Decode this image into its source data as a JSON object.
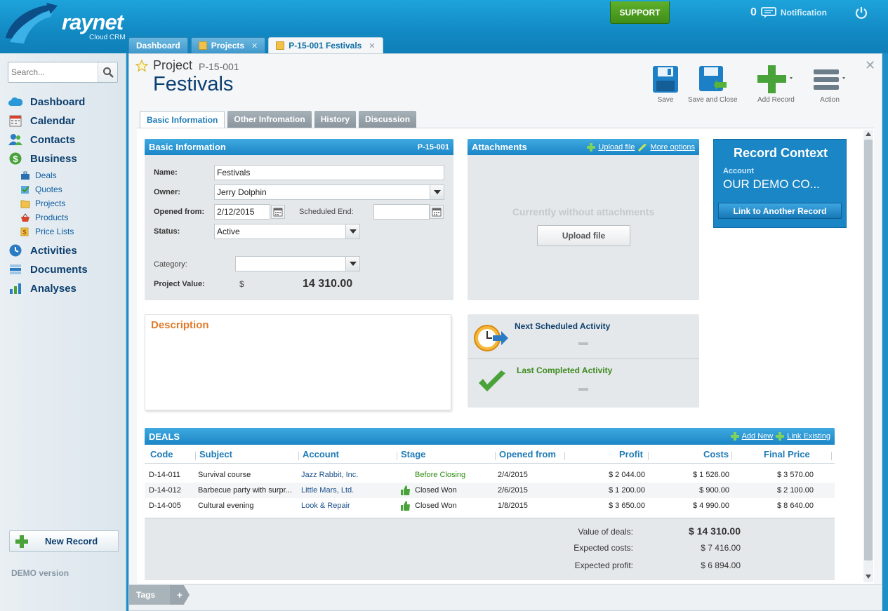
{
  "header": {
    "brand": "raynet",
    "brand_sub": "Cloud CRM",
    "support_label": "SUPPORT",
    "notification_count": "0",
    "notification_label": "Notification"
  },
  "tabs": [
    {
      "label": "Dashboard"
    },
    {
      "label": "Projects"
    },
    {
      "label": "P-15-001 Festivals"
    }
  ],
  "sidebar": {
    "search_placeholder": "Search...",
    "items": [
      {
        "label": "Dashboard"
      },
      {
        "label": "Calendar"
      },
      {
        "label": "Contacts"
      },
      {
        "label": "Business"
      },
      {
        "label": "Activities"
      },
      {
        "label": "Documents"
      },
      {
        "label": "Analyses"
      }
    ],
    "business_sub": [
      {
        "label": "Deals"
      },
      {
        "label": "Quotes"
      },
      {
        "label": "Projects"
      },
      {
        "label": "Products"
      },
      {
        "label": "Price Lists"
      }
    ],
    "new_record": "New Record",
    "demo": "DEMO version"
  },
  "record": {
    "type": "Project",
    "code": "P-15-001",
    "title": "Festivals"
  },
  "toolbar": {
    "save": "Save",
    "save_close": "Save and Close",
    "add_record": "Add Record",
    "action": "Action"
  },
  "subtabs": [
    "Basic Information",
    "Other Infromation",
    "History",
    "Discussion"
  ],
  "basic": {
    "title": "Basic Information",
    "code": "P-15-001",
    "name_label": "Name:",
    "name_value": "Festivals",
    "owner_label": "Owner:",
    "owner_value": "Jerry Dolphin",
    "opened_label": "Opened from:",
    "opened_value": "2/12/2015",
    "sched_label": "Scheduled End:",
    "status_label": "Status:",
    "status_value": "Active",
    "category_label": "Category:",
    "value_label": "Project Value:",
    "currency": "$",
    "value": "14 310.00"
  },
  "attachments": {
    "title": "Attachments",
    "upload_link": "Upload file",
    "more_link": "More options",
    "empty": "Currently without attachments",
    "upload_btn": "Upload file"
  },
  "context": {
    "title": "Record Context",
    "account_label": "Account",
    "account_value": "OUR DEMO CO...",
    "link_btn": "Link to Another Record"
  },
  "description": {
    "title": "Description"
  },
  "activities": {
    "next": "Next Scheduled Activity",
    "last": "Last Completed Activity"
  },
  "deals": {
    "title": "DEALS",
    "add_new": "Add New",
    "link_existing": "Link Existing",
    "columns": [
      "Code",
      "Subject",
      "Account",
      "Stage",
      "Opened from",
      "Profit",
      "Costs",
      "Final Price"
    ],
    "rows": [
      {
        "code": "D-14-011",
        "subject": "Survival course",
        "account": "Jazz Rabbit, Inc.",
        "stage": "Before Closing",
        "opened": "2/4/2015",
        "profit": "$ 2 044.00",
        "costs": "$ 1 526.00",
        "final": "$ 3 570.00"
      },
      {
        "code": "D-14-012",
        "subject": "Barbecue party with surpr...",
        "account": "Little Mars, Ltd.",
        "stage": "Closed Won",
        "opened": "2/6/2015",
        "profit": "$ 1 200.00",
        "costs": "$ 900.00",
        "final": "$ 2 100.00"
      },
      {
        "code": "D-14-005",
        "subject": "Cultural evening",
        "account": "Look & Repair",
        "stage": "Closed Won",
        "opened": "1/8/2015",
        "profit": "$ 3 650.00",
        "costs": "$ 4 990.00",
        "final": "$ 8 640.00"
      }
    ],
    "summary": {
      "value_label": "Value of deals:",
      "value": "$ 14 310.00",
      "costs_label": "Expected costs:",
      "costs": "$ 7 416.00",
      "profit_label": "Expected profit:",
      "profit": "$ 6 894.00"
    }
  },
  "tags": {
    "label": "Tags",
    "plus": "+"
  },
  "colors": {
    "accent": "#1b86c6",
    "support": "#4a9c20",
    "stage_green": "#2e8b12"
  }
}
